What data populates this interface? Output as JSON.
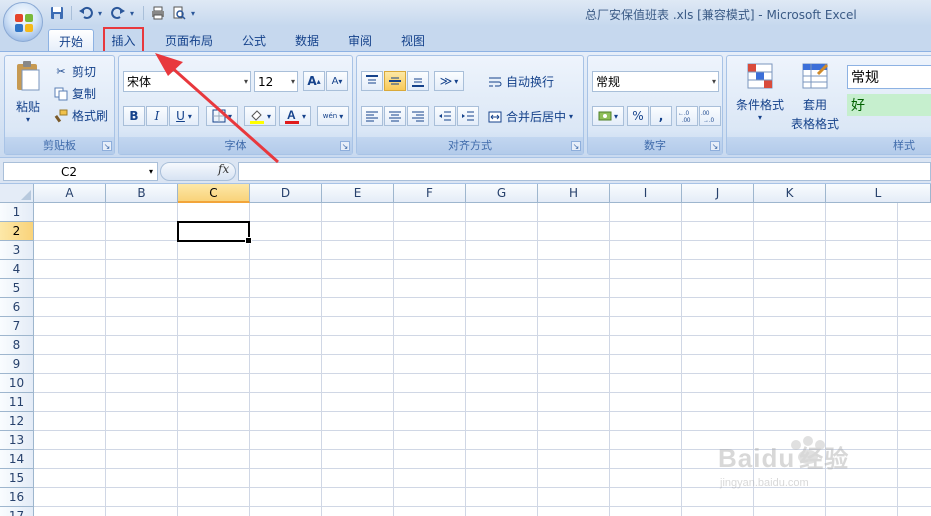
{
  "window": {
    "title": "总厂安保值班表 .xls  [兼容模式] - Microsoft Excel"
  },
  "qat": {
    "icons": [
      "save-icon",
      "undo-icon",
      "redo-icon",
      "print-icon",
      "print-preview-icon",
      "customize-icon"
    ]
  },
  "tabs": [
    {
      "label": "开始",
      "active": true
    },
    {
      "label": "插入",
      "highlighted": true
    },
    {
      "label": "页面布局"
    },
    {
      "label": "公式"
    },
    {
      "label": "数据"
    },
    {
      "label": "审阅"
    },
    {
      "label": "视图"
    }
  ],
  "clipboard": {
    "group_label": "剪贴板",
    "paste": "粘贴",
    "cut": "剪切",
    "copy": "复制",
    "format_painter": "格式刷"
  },
  "font": {
    "group_label": "字体",
    "name": "宋体",
    "size": "12",
    "bold": "B",
    "italic": "I",
    "underline": "U",
    "grow": "A",
    "shrink": "A",
    "phonetic": "wén"
  },
  "alignment": {
    "group_label": "对齐方式",
    "wrap_text": "自动换行",
    "merge_center": "合并后居中"
  },
  "number": {
    "group_label": "数字",
    "format": "常规",
    "percent": "%",
    "comma": ","
  },
  "styles": {
    "group_label": "样式",
    "conditional_formatting": "条件格式",
    "format_as_table_line1": "套用",
    "format_as_table_line2": "表格格式",
    "style_normal": "常规",
    "style_good": "好"
  },
  "formula_bar": {
    "name_box": "C2",
    "fx": "fx",
    "formula": ""
  },
  "columns": [
    "A",
    "B",
    "C",
    "D",
    "E",
    "F",
    "G",
    "H",
    "I",
    "J",
    "K",
    "L"
  ],
  "rows": [
    "1",
    "2",
    "3",
    "4",
    "5",
    "6",
    "7",
    "8",
    "9",
    "10",
    "11",
    "12",
    "13",
    "14",
    "15",
    "16",
    "17"
  ],
  "selection": {
    "column": "C",
    "row": "2"
  },
  "watermark": {
    "brand": "Baidu",
    "cn": "经验",
    "url": "jingyan.baidu.com"
  },
  "colors": {
    "accent": "#15428b",
    "highlight": "#e8383d",
    "selection": "#f9d37a"
  }
}
